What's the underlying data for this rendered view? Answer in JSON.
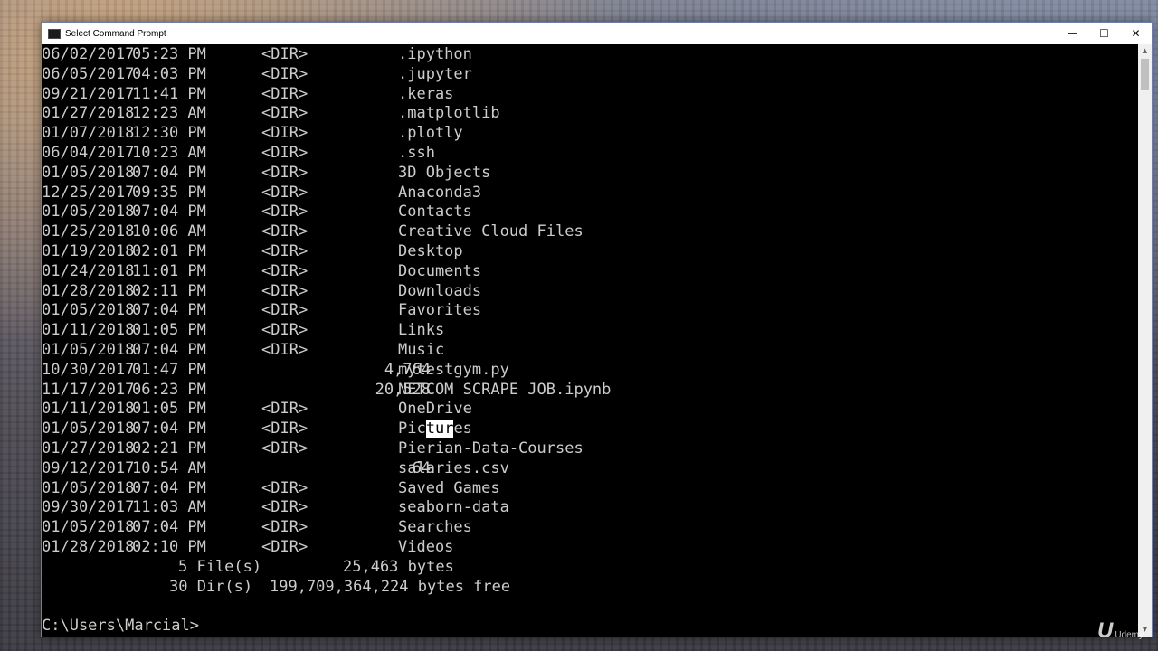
{
  "window": {
    "title": "Select Command Prompt",
    "minimize_label": "—",
    "maximize_label": "☐",
    "close_label": "✕"
  },
  "listing": [
    {
      "date": "06/02/2017",
      "time": "05:23 PM",
      "dir": "<DIR>",
      "size": "",
      "name": ".ipython"
    },
    {
      "date": "06/05/2017",
      "time": "04:03 PM",
      "dir": "<DIR>",
      "size": "",
      "name": ".jupyter"
    },
    {
      "date": "09/21/2017",
      "time": "11:41 PM",
      "dir": "<DIR>",
      "size": "",
      "name": ".keras"
    },
    {
      "date": "01/27/2018",
      "time": "12:23 AM",
      "dir": "<DIR>",
      "size": "",
      "name": ".matplotlib"
    },
    {
      "date": "01/07/2018",
      "time": "12:30 PM",
      "dir": "<DIR>",
      "size": "",
      "name": ".plotly"
    },
    {
      "date": "06/04/2017",
      "time": "10:23 AM",
      "dir": "<DIR>",
      "size": "",
      "name": ".ssh"
    },
    {
      "date": "01/05/2018",
      "time": "07:04 PM",
      "dir": "<DIR>",
      "size": "",
      "name": "3D Objects"
    },
    {
      "date": "12/25/2017",
      "time": "09:35 PM",
      "dir": "<DIR>",
      "size": "",
      "name": "Anaconda3"
    },
    {
      "date": "01/05/2018",
      "time": "07:04 PM",
      "dir": "<DIR>",
      "size": "",
      "name": "Contacts"
    },
    {
      "date": "01/25/2018",
      "time": "10:06 AM",
      "dir": "<DIR>",
      "size": "",
      "name": "Creative Cloud Files"
    },
    {
      "date": "01/19/2018",
      "time": "02:01 PM",
      "dir": "<DIR>",
      "size": "",
      "name": "Desktop"
    },
    {
      "date": "01/24/2018",
      "time": "11:01 PM",
      "dir": "<DIR>",
      "size": "",
      "name": "Documents"
    },
    {
      "date": "01/28/2018",
      "time": "02:11 PM",
      "dir": "<DIR>",
      "size": "",
      "name": "Downloads"
    },
    {
      "date": "01/05/2018",
      "time": "07:04 PM",
      "dir": "<DIR>",
      "size": "",
      "name": "Favorites"
    },
    {
      "date": "01/11/2018",
      "time": "01:05 PM",
      "dir": "<DIR>",
      "size": "",
      "name": "Links"
    },
    {
      "date": "01/05/2018",
      "time": "07:04 PM",
      "dir": "<DIR>",
      "size": "",
      "name": "Music"
    },
    {
      "date": "10/30/2017",
      "time": "01:47 PM",
      "dir": "",
      "size": "4,764",
      "name": "mytestgym.py"
    },
    {
      "date": "11/17/2017",
      "time": "06:23 PM",
      "dir": "",
      "size": "20,528",
      "name": "NETCOM SCRAPE JOB.ipynb"
    },
    {
      "date": "01/11/2018",
      "time": "01:05 PM",
      "dir": "<DIR>",
      "size": "",
      "name": "OneDrive"
    },
    {
      "date": "01/05/2018",
      "time": "07:04 PM",
      "dir": "<DIR>",
      "size": "",
      "name": "Pictures",
      "sel_pre": "Pic",
      "sel_mid": "tur",
      "sel_post": "es"
    },
    {
      "date": "01/27/2018",
      "time": "02:21 PM",
      "dir": "<DIR>",
      "size": "",
      "name": "Pierian-Data-Courses"
    },
    {
      "date": "09/12/2017",
      "time": "10:54 AM",
      "dir": "",
      "size": "64",
      "name": "salaries.csv"
    },
    {
      "date": "01/05/2018",
      "time": "07:04 PM",
      "dir": "<DIR>",
      "size": "",
      "name": "Saved Games"
    },
    {
      "date": "09/30/2017",
      "time": "11:03 AM",
      "dir": "<DIR>",
      "size": "",
      "name": "seaborn-data"
    },
    {
      "date": "01/05/2018",
      "time": "07:04 PM",
      "dir": "<DIR>",
      "size": "",
      "name": "Searches"
    },
    {
      "date": "01/28/2018",
      "time": "02:10 PM",
      "dir": "<DIR>",
      "size": "",
      "name": "Videos"
    }
  ],
  "summary": {
    "files": "5 File(s)",
    "files_bytes": "25,463 bytes",
    "dirs": "30 Dir(s)",
    "dirs_bytes": "199,709,364,224 bytes free"
  },
  "prompt": "C:\\Users\\Marcial>",
  "watermark": {
    "logo": "U",
    "text": "Udemy"
  },
  "icons": {
    "titlebar": "command-prompt-icon",
    "cursor": "mouse-pointer-icon"
  },
  "colors": {
    "terminal_bg": "#000000",
    "terminal_fg": "#cccccc",
    "selection_bg": "#ffffff",
    "titlebar_bg": "#ffffff"
  }
}
